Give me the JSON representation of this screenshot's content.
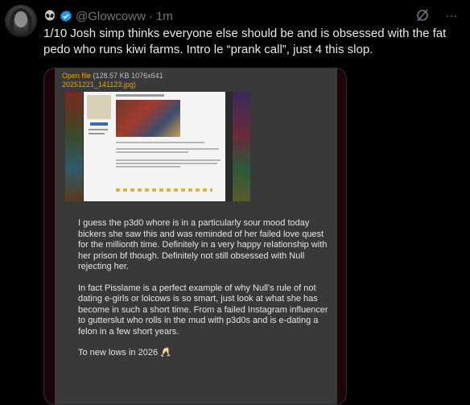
{
  "author": {
    "handle": "@Glowcoww",
    "separator": "·",
    "timestamp": "1m",
    "badge_icon": "alien-icon",
    "verified_icon": "verified-badge-icon",
    "accent": "#1d9bf0"
  },
  "tweet": {
    "text": "1/10 Josh simp thinks everyone else should be and is obsessed with the fat pedo who runs kiwi farms. Intro le “prank call”, just 4 this slop."
  },
  "actions": {
    "grok_icon": "grok-icon",
    "more_icon": "more-icon",
    "more_glyph": "···"
  },
  "media": {
    "open_file_label": "Open file",
    "file_meta": " (128.57 KB 1076x641",
    "file_name": "20251221_141123.jpg)",
    "paragraphs": [
      "I guess the p3d0 whore is in a particularly sour mood today bickers she saw this and was reminded of her failed love quest for the millionth time. Definitely in a very happy relationship with her prison bf though. Definitely not still obsessed with Null rejecting her.",
      "In fact Pisslame is a perfect example of why Null's rule of not dating e-girls or lolcows is so smart, just look at what she has become in such a short time. From a failed Instagram influencer to gutterslut who rolls in the mud with p3d0s and is e-dating a felon in a few short years.",
      "To new lows in 2026 🥂"
    ]
  }
}
